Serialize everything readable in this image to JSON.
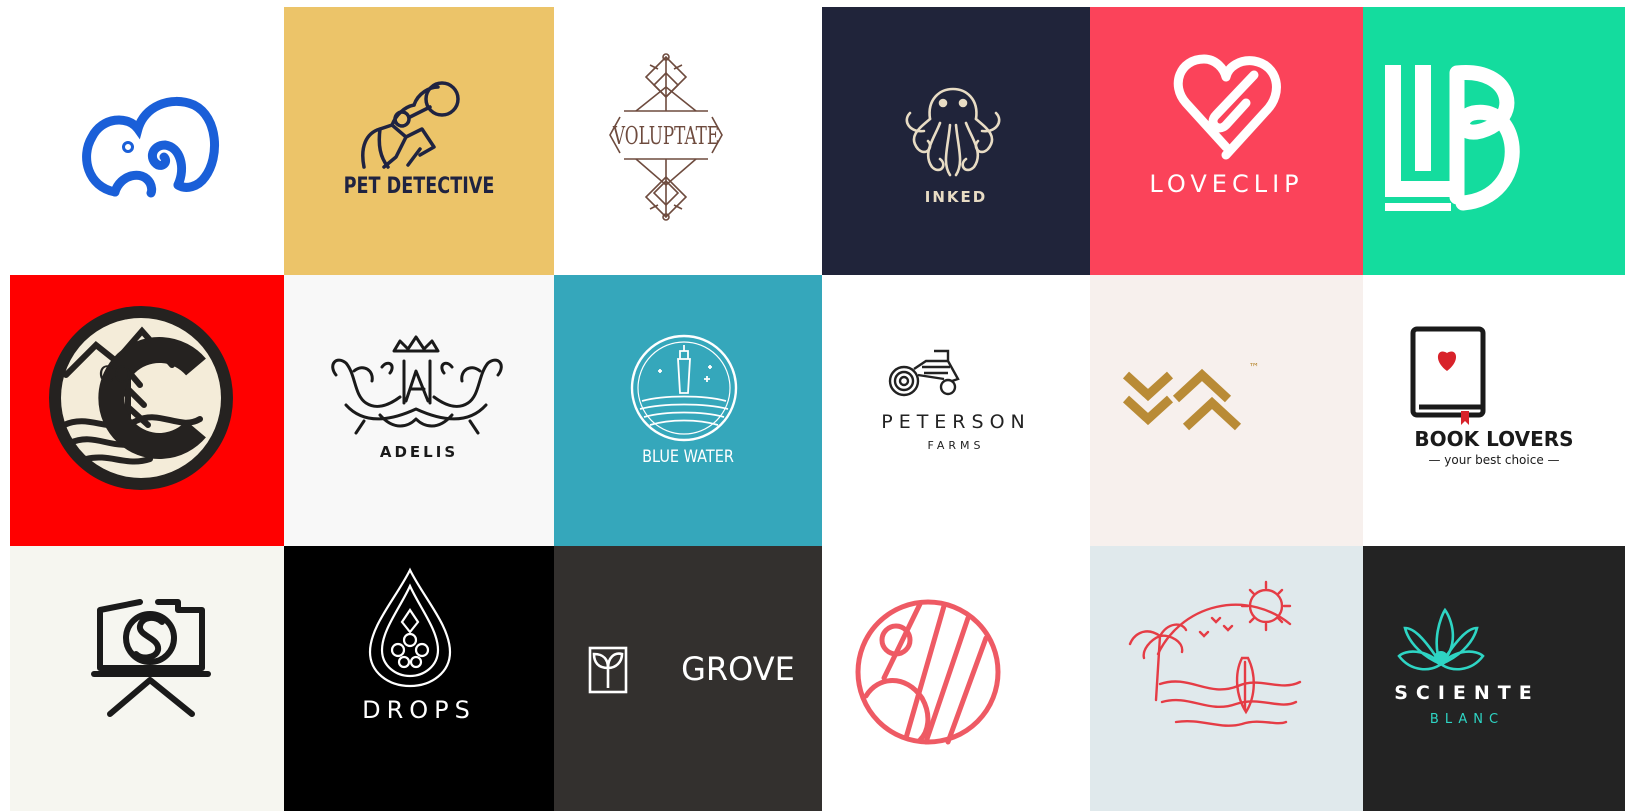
{
  "logos": [
    {
      "id": "elephant",
      "text": "",
      "icon": "elephant-icon",
      "bg": "#ffffff",
      "fg": "#1a5fd8"
    },
    {
      "id": "pet-detective",
      "text": "PET DETECTIVE",
      "icon": "dog-detective-icon",
      "bg": "#ecc469",
      "fg": "#1f2341"
    },
    {
      "id": "voluptate",
      "text": "VOLUPTATE",
      "icon": "ornament-icon",
      "bg": "#ffffff",
      "fg": "#6e4b3e"
    },
    {
      "id": "inked",
      "text": "INKED",
      "icon": "octopus-icon",
      "bg": "#20243a",
      "fg": "#e8dcc4"
    },
    {
      "id": "loveclip",
      "text": "LOVECLIP",
      "icon": "heart-paperclip-icon",
      "bg": "#fb435a",
      "fg": "#ffffff"
    },
    {
      "id": "lb",
      "text": "",
      "icon": "lb-monogram-icon",
      "bg": "#14dc9e",
      "fg": "#ffffff"
    },
    {
      "id": "colorado",
      "text": "CO",
      "icon": "mountain-tree-badge-icon",
      "bg": "#ff0000",
      "fg": "#252220"
    },
    {
      "id": "adelis",
      "text": "ADELIS",
      "icon": "birds-crest-icon",
      "bg": "#f8f8f8",
      "fg": "#1a1a1a"
    },
    {
      "id": "blue-water",
      "text": "BLUE WATER",
      "icon": "lighthouse-icon",
      "bg": "#35a7bb",
      "fg": "#ffffff"
    },
    {
      "id": "peterson",
      "text": "PETERSON",
      "subtext": "FARMS",
      "icon": "tractor-icon",
      "bg": "#ffffff",
      "fg": "#222222"
    },
    {
      "id": "va",
      "text": "™",
      "icon": "va-chevrons-icon",
      "bg": "#f7f0ed",
      "fg": "#b98b36"
    },
    {
      "id": "book-lovers",
      "text": "BOOK LOVERS",
      "subtext": "— your best choice —",
      "icon": "book-heart-icon",
      "bg": "#ffffff",
      "fg": "#1a1a1a"
    },
    {
      "id": "camera",
      "text": "",
      "icon": "camera-tripod-icon",
      "bg": "#f6f6f0",
      "fg": "#1a1a1a"
    },
    {
      "id": "drops",
      "text": "DROPS",
      "icon": "drop-icon",
      "bg": "#000000",
      "fg": "#ffffff"
    },
    {
      "id": "grove",
      "text": "GROVE",
      "icon": "leaf-box-icon",
      "bg": "#33302e",
      "fg": "#ffffff"
    },
    {
      "id": "sun-circle",
      "text": "",
      "icon": "circle-lines-icon",
      "bg": "#ffffff",
      "fg": "#ee5a64"
    },
    {
      "id": "beach",
      "text": "",
      "icon": "beach-palm-icon",
      "bg": "#e0e9ec",
      "fg": "#e53c45"
    },
    {
      "id": "sciente",
      "text": "SCIENTE",
      "subtext": "BLANC",
      "icon": "lotus-icon",
      "bg": "#232323",
      "fg": "#ffffff",
      "accent": "#2ed5c4"
    }
  ]
}
